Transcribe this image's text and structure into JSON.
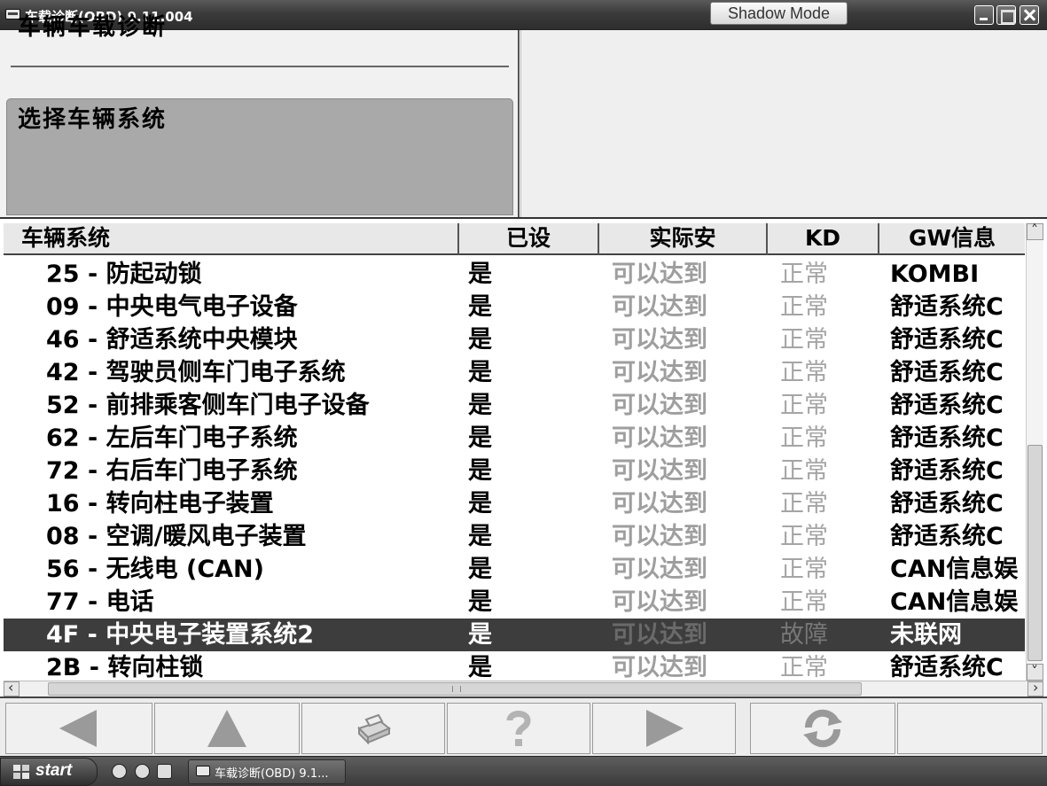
{
  "window": {
    "title": "车载诊断(OBD) 9.11.004",
    "shadow_mode_label": "Shadow Mode"
  },
  "header": {
    "title": "车辆车载诊断",
    "prompt": "选择车辆系统"
  },
  "table": {
    "columns": [
      "车辆系统",
      "已设",
      "实际安",
      "KD",
      "GW信息"
    ],
    "rows": [
      {
        "name": "25 - 防起动锁",
        "set": "是",
        "actual": "可以达到",
        "kd": "正常",
        "gw": "KOMBI"
      },
      {
        "name": "09 - 中央电气电子设备",
        "set": "是",
        "actual": "可以达到",
        "kd": "正常",
        "gw": "舒适系统C"
      },
      {
        "name": "46 - 舒适系统中央模块",
        "set": "是",
        "actual": "可以达到",
        "kd": "正常",
        "gw": "舒适系统C"
      },
      {
        "name": "42 - 驾驶员侧车门电子系统",
        "set": "是",
        "actual": "可以达到",
        "kd": "正常",
        "gw": "舒适系统C"
      },
      {
        "name": "52 - 前排乘客侧车门电子设备",
        "set": "是",
        "actual": "可以达到",
        "kd": "正常",
        "gw": "舒适系统C"
      },
      {
        "name": "62 - 左后车门电子系统",
        "set": "是",
        "actual": "可以达到",
        "kd": "正常",
        "gw": "舒适系统C"
      },
      {
        "name": "72 - 右后车门电子系统",
        "set": "是",
        "actual": "可以达到",
        "kd": "正常",
        "gw": "舒适系统C"
      },
      {
        "name": "16 - 转向柱电子装置",
        "set": "是",
        "actual": "可以达到",
        "kd": "正常",
        "gw": "舒适系统C"
      },
      {
        "name": "08 - 空调/暖风电子装置",
        "set": "是",
        "actual": "可以达到",
        "kd": "正常",
        "gw": "舒适系统C"
      },
      {
        "name": "56 - 无线电 (CAN)",
        "set": "是",
        "actual": "可以达到",
        "kd": "正常",
        "gw": "CAN信息娱"
      },
      {
        "name": "77 - 电话",
        "set": "是",
        "actual": "可以达到",
        "kd": "正常",
        "gw": "CAN信息娱"
      },
      {
        "name": "4F - 中央电子装置系统2",
        "set": "是",
        "actual": "可以达到",
        "kd": "故障",
        "gw": "未联网"
      },
      {
        "name": "2B - 转向柱锁",
        "set": "是",
        "actual": "可以达到",
        "kd": "正常",
        "gw": "舒适系统C"
      }
    ],
    "selected_index": 11
  },
  "toolbar": {
    "icons": [
      "arrow-left-icon",
      "arrow-up-icon",
      "printer-icon",
      "help-icon",
      "arrow-right-icon",
      "refresh-icon"
    ]
  },
  "taskbar": {
    "start_label": "start",
    "task_label": "车载诊断(OBD) 9.1..."
  },
  "colors": {
    "selected_row_bg": "#3d3d3d",
    "dim_text": "#9e9e9e",
    "prompt_bg": "#a9a9a9"
  }
}
